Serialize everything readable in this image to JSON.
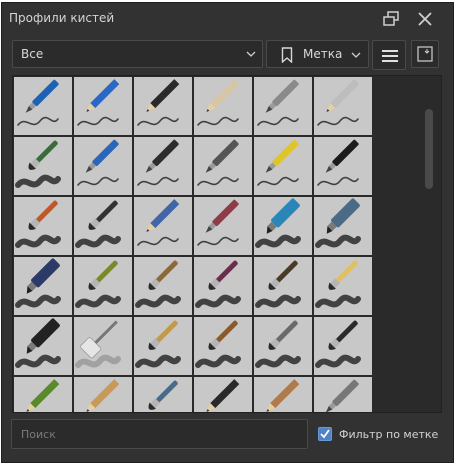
{
  "title": "Профили кистей",
  "colors": {
    "panel": "#323232",
    "tile": "#c8c8c8",
    "accent": "#4f83c5"
  },
  "toolbar": {
    "resource_filter": "Все",
    "tag_label": "Метка",
    "float_icon": "float-window-icon",
    "close_icon": "close-icon",
    "menu_icon": "hamburger-menu-icon",
    "view_icon": "view-mode-icon"
  },
  "search": {
    "placeholder": "Поиск"
  },
  "filter": {
    "label": "Фильтр по метке",
    "checked": true
  },
  "brushes": [
    {
      "kind": "pen",
      "color": "#1e62b5"
    },
    {
      "kind": "pencil",
      "color": "#2968c4"
    },
    {
      "kind": "pencil",
      "color": "#2a2a2a"
    },
    {
      "kind": "pencil",
      "color": "#d7c6a6"
    },
    {
      "kind": "pen",
      "color": "#8a8a8a"
    },
    {
      "kind": "pencil",
      "color": "#bdbdbd"
    },
    {
      "kind": "brush",
      "color": "#3b6b3a"
    },
    {
      "kind": "pen",
      "color": "#2b66b8"
    },
    {
      "kind": "pen",
      "color": "#2c2c2c"
    },
    {
      "kind": "pen",
      "color": "#555555"
    },
    {
      "kind": "pen",
      "color": "#e0c52a"
    },
    {
      "kind": "pen",
      "color": "#1b1b1b"
    },
    {
      "kind": "brush",
      "color": "#c0572a"
    },
    {
      "kind": "brush",
      "color": "#333333"
    },
    {
      "kind": "pencil",
      "color": "#3f66a6"
    },
    {
      "kind": "pen",
      "color": "#8e3b4a"
    },
    {
      "kind": "marker",
      "color": "#2a85b8"
    },
    {
      "kind": "marker",
      "color": "#4b6a86"
    },
    {
      "kind": "marker",
      "color": "#2b3a66"
    },
    {
      "kind": "brush",
      "color": "#7a8a2a"
    },
    {
      "kind": "brush",
      "color": "#8b6a3a"
    },
    {
      "kind": "brush",
      "color": "#6a2d4b"
    },
    {
      "kind": "brush",
      "color": "#4a3a2a"
    },
    {
      "kind": "brush",
      "color": "#e0c060"
    },
    {
      "kind": "marker",
      "color": "#222222"
    },
    {
      "kind": "roller",
      "color": "#e5e5e5"
    },
    {
      "kind": "brush",
      "color": "#c29a4a"
    },
    {
      "kind": "brush",
      "color": "#8a5a2a"
    },
    {
      "kind": "brush",
      "color": "#6a6a6a"
    },
    {
      "kind": "brush",
      "color": "#2a2a2a"
    },
    {
      "kind": "pencil",
      "color": "#5a8a2a"
    },
    {
      "kind": "pencil",
      "color": "#c89a5a"
    },
    {
      "kind": "brush",
      "color": "#4a6a8a"
    },
    {
      "kind": "pencil",
      "color": "#2a2a2a"
    },
    {
      "kind": "pencil",
      "color": "#b07a4a"
    },
    {
      "kind": "pen",
      "color": "#777777"
    }
  ]
}
